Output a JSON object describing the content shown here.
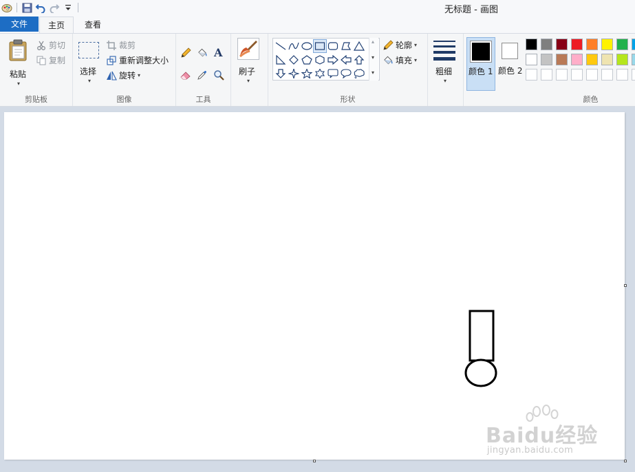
{
  "window": {
    "title": "无标题 - 画图"
  },
  "tabs": {
    "file": "文件",
    "home": "主页",
    "view": "查看"
  },
  "clipboard": {
    "paste": "粘贴",
    "cut": "剪切",
    "copy": "复制",
    "group": "剪贴板"
  },
  "image": {
    "select": "选择",
    "crop": "裁剪",
    "resize": "重新调整大小",
    "rotate": "旋转",
    "group": "图像"
  },
  "tools": {
    "group": "工具"
  },
  "brushes": {
    "label": "刷子"
  },
  "shapes": {
    "outline": "轮廓",
    "fill": "填充",
    "group": "形状"
  },
  "size": {
    "label": "粗细"
  },
  "colors": {
    "color1": "颜色 1",
    "color2": "颜色 2",
    "group": "颜色",
    "color1_value": "#000000",
    "color2_value": "#ffffff",
    "palette_row1": [
      "#000000",
      "#7f7f7f",
      "#880015",
      "#ed1c24",
      "#ff7f27",
      "#fff200",
      "#22b14c",
      "#00a2e8"
    ],
    "palette_row2": [
      "#ffffff",
      "#c3c3c3",
      "#b97a57",
      "#ffaec9",
      "#ffc90e",
      "#efe4b0",
      "#b5e61d",
      "#99d9ea"
    ],
    "palette_row3": [
      "#ffffff",
      "#ffffff",
      "#ffffff",
      "#ffffff",
      "#ffffff",
      "#ffffff",
      "#ffffff",
      "#ffffff"
    ]
  },
  "watermark": {
    "logo": "Baidu经验",
    "url": "jingyan.baidu.com"
  }
}
